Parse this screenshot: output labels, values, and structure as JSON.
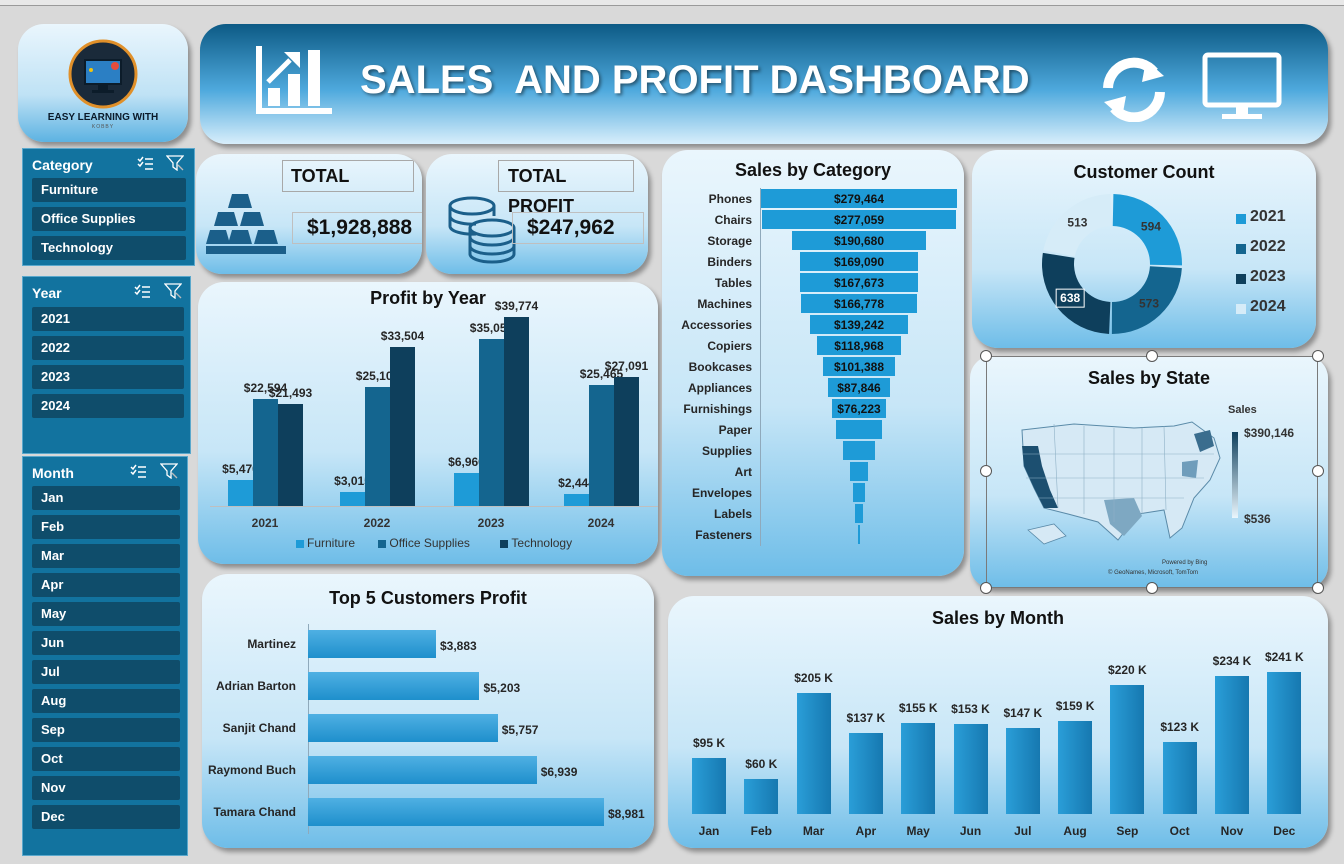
{
  "header": {
    "logo_text": "EASY LEARNING WITH",
    "logo_subtext": "KOBBY",
    "title": "SALES  AND PROFIT DASHBOARD"
  },
  "slicers": {
    "category": {
      "title": "Category",
      "items": [
        "Furniture",
        "Office Supplies",
        "Technology"
      ]
    },
    "year": {
      "title": "Year",
      "items": [
        "2021",
        "2022",
        "2023",
        "2024"
      ]
    },
    "month": {
      "title": "Month",
      "items": [
        "Jan",
        "Feb",
        "Mar",
        "Apr",
        "May",
        "Jun",
        "Jul",
        "Aug",
        "Sep",
        "Oct",
        "Nov",
        "Dec"
      ]
    }
  },
  "kpis": {
    "total_label": "TOTAL",
    "total_value": "$1,928,888",
    "profit_label": "TOTAL PROFIT",
    "profit_value": "$247,962"
  },
  "colors": {
    "furniture": "#1e9bd7",
    "office_supplies": "#14658f",
    "technology": "#0e3f5c",
    "panel_light": "#eaf6fd",
    "panel_dark": "#6ebde8",
    "slicer_bg": "#12739f",
    "slicer_item": "#0f4d6b"
  },
  "charts": {
    "profit_by_year": {
      "title": "Profit by Year",
      "type": "bar",
      "categories": [
        "2021",
        "2022",
        "2023",
        "2024"
      ],
      "series": [
        {
          "name": "Furniture",
          "values": [
            5470,
            3015,
            6960,
            2444
          ],
          "labels": [
            "$5,470",
            "$3,015",
            "$6,960",
            "$2,444"
          ]
        },
        {
          "name": "Office Supplies",
          "values": [
            22594,
            25100,
            35053,
            25465
          ],
          "labels": [
            "$22,594",
            "$25,100",
            "$35,053",
            "$25,465"
          ]
        },
        {
          "name": "Technology",
          "values": [
            21493,
            33504,
            39774,
            27091
          ],
          "labels": [
            "$21,493",
            "$33,504",
            "$39,774",
            "$27,091"
          ]
        }
      ],
      "ylim": [
        0,
        40000
      ]
    },
    "sales_by_category": {
      "title": "Sales by Category",
      "type": "bar",
      "categories": [
        "Phones",
        "Chairs",
        "Storage",
        "Binders",
        "Tables",
        "Machines",
        "Accessories",
        "Copiers",
        "Bookcases",
        "Appliances",
        "Furnishings",
        "Paper",
        "Supplies",
        "Art",
        "Envelopes",
        "Labels",
        "Fasteners"
      ],
      "values": [
        279464,
        277059,
        190680,
        169090,
        167673,
        166778,
        139242,
        118968,
        101388,
        87846,
        76223,
        66000,
        45000,
        27000,
        16500,
        12500,
        3000
      ],
      "labels": [
        "$279,464",
        "$277,059",
        "$190,680",
        "$169,090",
        "$167,673",
        "$166,778",
        "$139,242",
        "$118,968",
        "$101,388",
        "$87,846",
        "$76,223",
        "",
        "",
        "",
        "",
        "",
        ""
      ]
    },
    "customer_count": {
      "title": "Customer Count",
      "type": "pie",
      "categories": [
        "2021",
        "2022",
        "2023",
        "2024"
      ],
      "values": [
        594,
        573,
        638,
        513
      ]
    },
    "sales_by_state": {
      "title": "Sales by State",
      "legend_title": "Sales",
      "max_label": "$390,146",
      "min_label": "$536",
      "credit_1": "Powered by Bing",
      "credit_2": "© GeoNames, Microsoft, TomTom"
    },
    "top5_customers": {
      "title": "Top 5 Customers Profit",
      "type": "bar",
      "categories": [
        "Martinez",
        "Adrian Barton",
        "Sanjit Chand",
        "Raymond Buch",
        "Tamara Chand"
      ],
      "values": [
        3883,
        5203,
        5757,
        6939,
        8981
      ],
      "labels": [
        "$3,883",
        "$5,203",
        "$5,757",
        "$6,939",
        "$8,981"
      ]
    },
    "sales_by_month": {
      "title": "Sales by Month",
      "type": "bar",
      "categories": [
        "Jan",
        "Feb",
        "Mar",
        "Apr",
        "May",
        "Jun",
        "Jul",
        "Aug",
        "Sep",
        "Oct",
        "Nov",
        "Dec"
      ],
      "values": [
        95,
        60,
        205,
        137,
        155,
        153,
        147,
        159,
        220,
        123,
        234,
        241
      ],
      "labels": [
        "$95 K",
        "$60 K",
        "$205 K",
        "$137 K",
        "$155 K",
        "$153 K",
        "$147 K",
        "$159 K",
        "$220 K",
        "$123 K",
        "$234 K",
        "$241 K"
      ]
    }
  }
}
